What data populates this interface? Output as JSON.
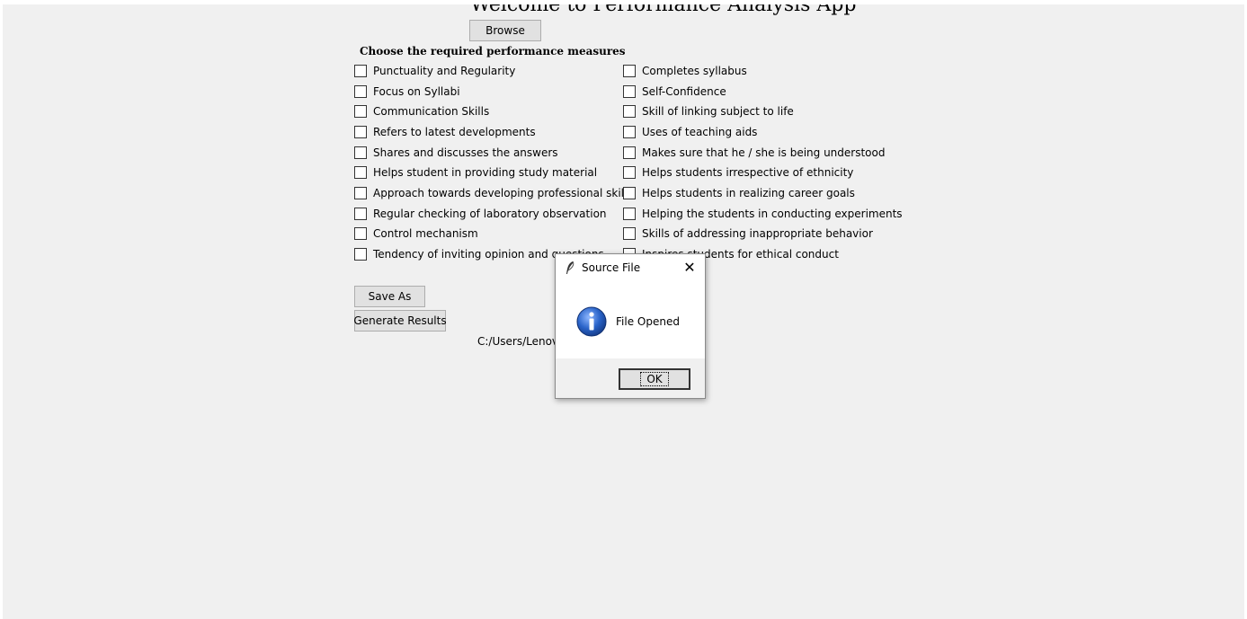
{
  "app": {
    "title": "Welcome to Performance Analysis App",
    "browse_label": "Browse",
    "measures_heading": "Choose the required performance measures",
    "save_as_label": "Save As",
    "generate_label": "Generate Results",
    "file_path": "C:/Users/Lenovo/Desktop/Sheet3 (8).csv"
  },
  "measures_left": [
    {
      "label": "Punctuality and Regularity",
      "checked": false
    },
    {
      "label": "Focus on Syllabi",
      "checked": false
    },
    {
      "label": "Communication Skills",
      "checked": false
    },
    {
      "label": "Refers to latest developments",
      "checked": false
    },
    {
      "label": "Shares and discusses the answers",
      "checked": false
    },
    {
      "label": "Helps student in providing study material",
      "checked": false
    },
    {
      "label": "Approach towards developing professional skills",
      "checked": false
    },
    {
      "label": "Regular checking of laboratory observation",
      "checked": false
    },
    {
      "label": "Control mechanism",
      "checked": false
    },
    {
      "label": "Tendency of inviting opinion and questions",
      "checked": false
    }
  ],
  "measures_right": [
    {
      "label": "Completes syllabus",
      "checked": false
    },
    {
      "label": "Self-Confidence",
      "checked": false
    },
    {
      "label": "Skill of linking subject to life",
      "checked": false
    },
    {
      "label": "Uses of teaching aids",
      "checked": false
    },
    {
      "label": "Makes sure that he / she is being understood",
      "checked": false
    },
    {
      "label": "Helps students irrespective of ethnicity",
      "checked": false
    },
    {
      "label": "Helps students in realizing career goals",
      "checked": false
    },
    {
      "label": "Helping the students in conducting experiments",
      "checked": false
    },
    {
      "label": "Skills of addressing inappropriate behavior",
      "checked": false
    },
    {
      "label": "Inspires students for ethical conduct",
      "checked": false
    }
  ],
  "dialog": {
    "title": "Source File",
    "message": "File Opened",
    "ok_label": "OK",
    "close_icon": "close-icon",
    "info_icon": "info-icon",
    "app_icon": "feather-icon"
  },
  "colors": {
    "window_bg": "#f0f0f0",
    "button_bg": "#e1e1e1",
    "info_blue": "#1f5fbf"
  }
}
